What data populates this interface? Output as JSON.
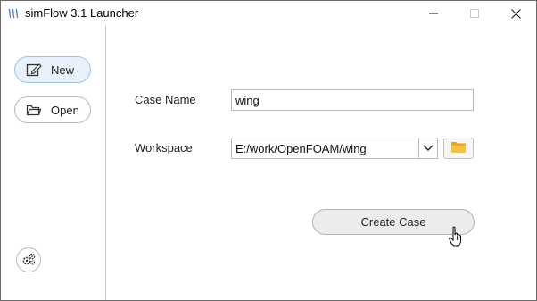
{
  "window": {
    "title": "simFlow 3.1 Launcher",
    "icon": "simflow-logo-icon",
    "controls": [
      "minimize-icon",
      "maximize-icon",
      "close-icon"
    ]
  },
  "sidebar": {
    "items": [
      {
        "label": "New",
        "icon": "edit-icon",
        "active": true
      },
      {
        "label": "Open",
        "icon": "folder-outline-icon",
        "active": false
      }
    ],
    "settings_icon": "gears-icon"
  },
  "form": {
    "case_name_label": "Case Name",
    "case_name_value": "wing",
    "workspace_label": "Workspace",
    "workspace_value": "E:/work/OpenFOAM/wing",
    "browse_icon": "folder-icon"
  },
  "actions": {
    "create_label": "Create Case"
  },
  "colors": {
    "active_bg": "#e8f1fb",
    "folder": "#f2b632"
  }
}
